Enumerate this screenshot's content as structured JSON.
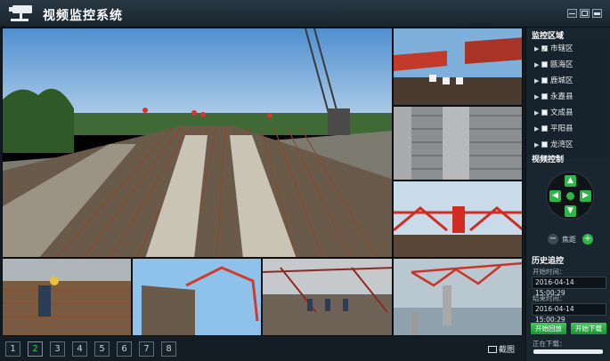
{
  "app": {
    "title": "视频监控系统"
  },
  "window_controls": [
    "minimize-icon",
    "maximize-icon",
    "close-icon"
  ],
  "video_feeds": [
    {
      "name": "feed-main",
      "scene": "bridge deck rebar construction"
    },
    {
      "name": "feed-top-right-1",
      "scene": "bridge girder erection"
    },
    {
      "name": "feed-top-right-2",
      "scene": "deck rebar close-up"
    },
    {
      "name": "feed-top-right-3",
      "scene": "red gantry crane"
    },
    {
      "name": "feed-bottom-1",
      "scene": "workers tying rebar"
    },
    {
      "name": "feed-bottom-2",
      "scene": "concrete pump boom"
    },
    {
      "name": "feed-bottom-3",
      "scene": "steel frame site"
    },
    {
      "name": "feed-bottom-4",
      "scene": "bridge launching gantry over sea"
    }
  ],
  "pager": {
    "pages": [
      "1",
      "2",
      "3",
      "4",
      "5",
      "6",
      "7",
      "8"
    ],
    "active": "2"
  },
  "snapshot_label": "截图",
  "sidebar": {
    "region_title": "监控区域",
    "regions": [
      {
        "label": "市辖区",
        "checked": true
      },
      {
        "label": "瓯海区",
        "checked": false
      },
      {
        "label": "鹿城区",
        "checked": false
      },
      {
        "label": "永嘉县",
        "checked": false
      },
      {
        "label": "文成县",
        "checked": false
      },
      {
        "label": "平阳县",
        "checked": false
      },
      {
        "label": "龙湾区",
        "checked": false
      }
    ],
    "ptz_title": "视频控制",
    "zoom_label": "焦距",
    "history_title": "历史追控",
    "start_label": "开始时间：",
    "start_value": "2016-04-14 15:00:29",
    "end_label": "结束时间：",
    "end_value": "2016-04-14 15:00:29",
    "playback_button": "开始回放",
    "download_button": "开始下载",
    "download_status": "正在下载："
  },
  "colors": {
    "accent": "#2fb64a",
    "background": "#0f1a22",
    "panel": "#1a262f"
  }
}
